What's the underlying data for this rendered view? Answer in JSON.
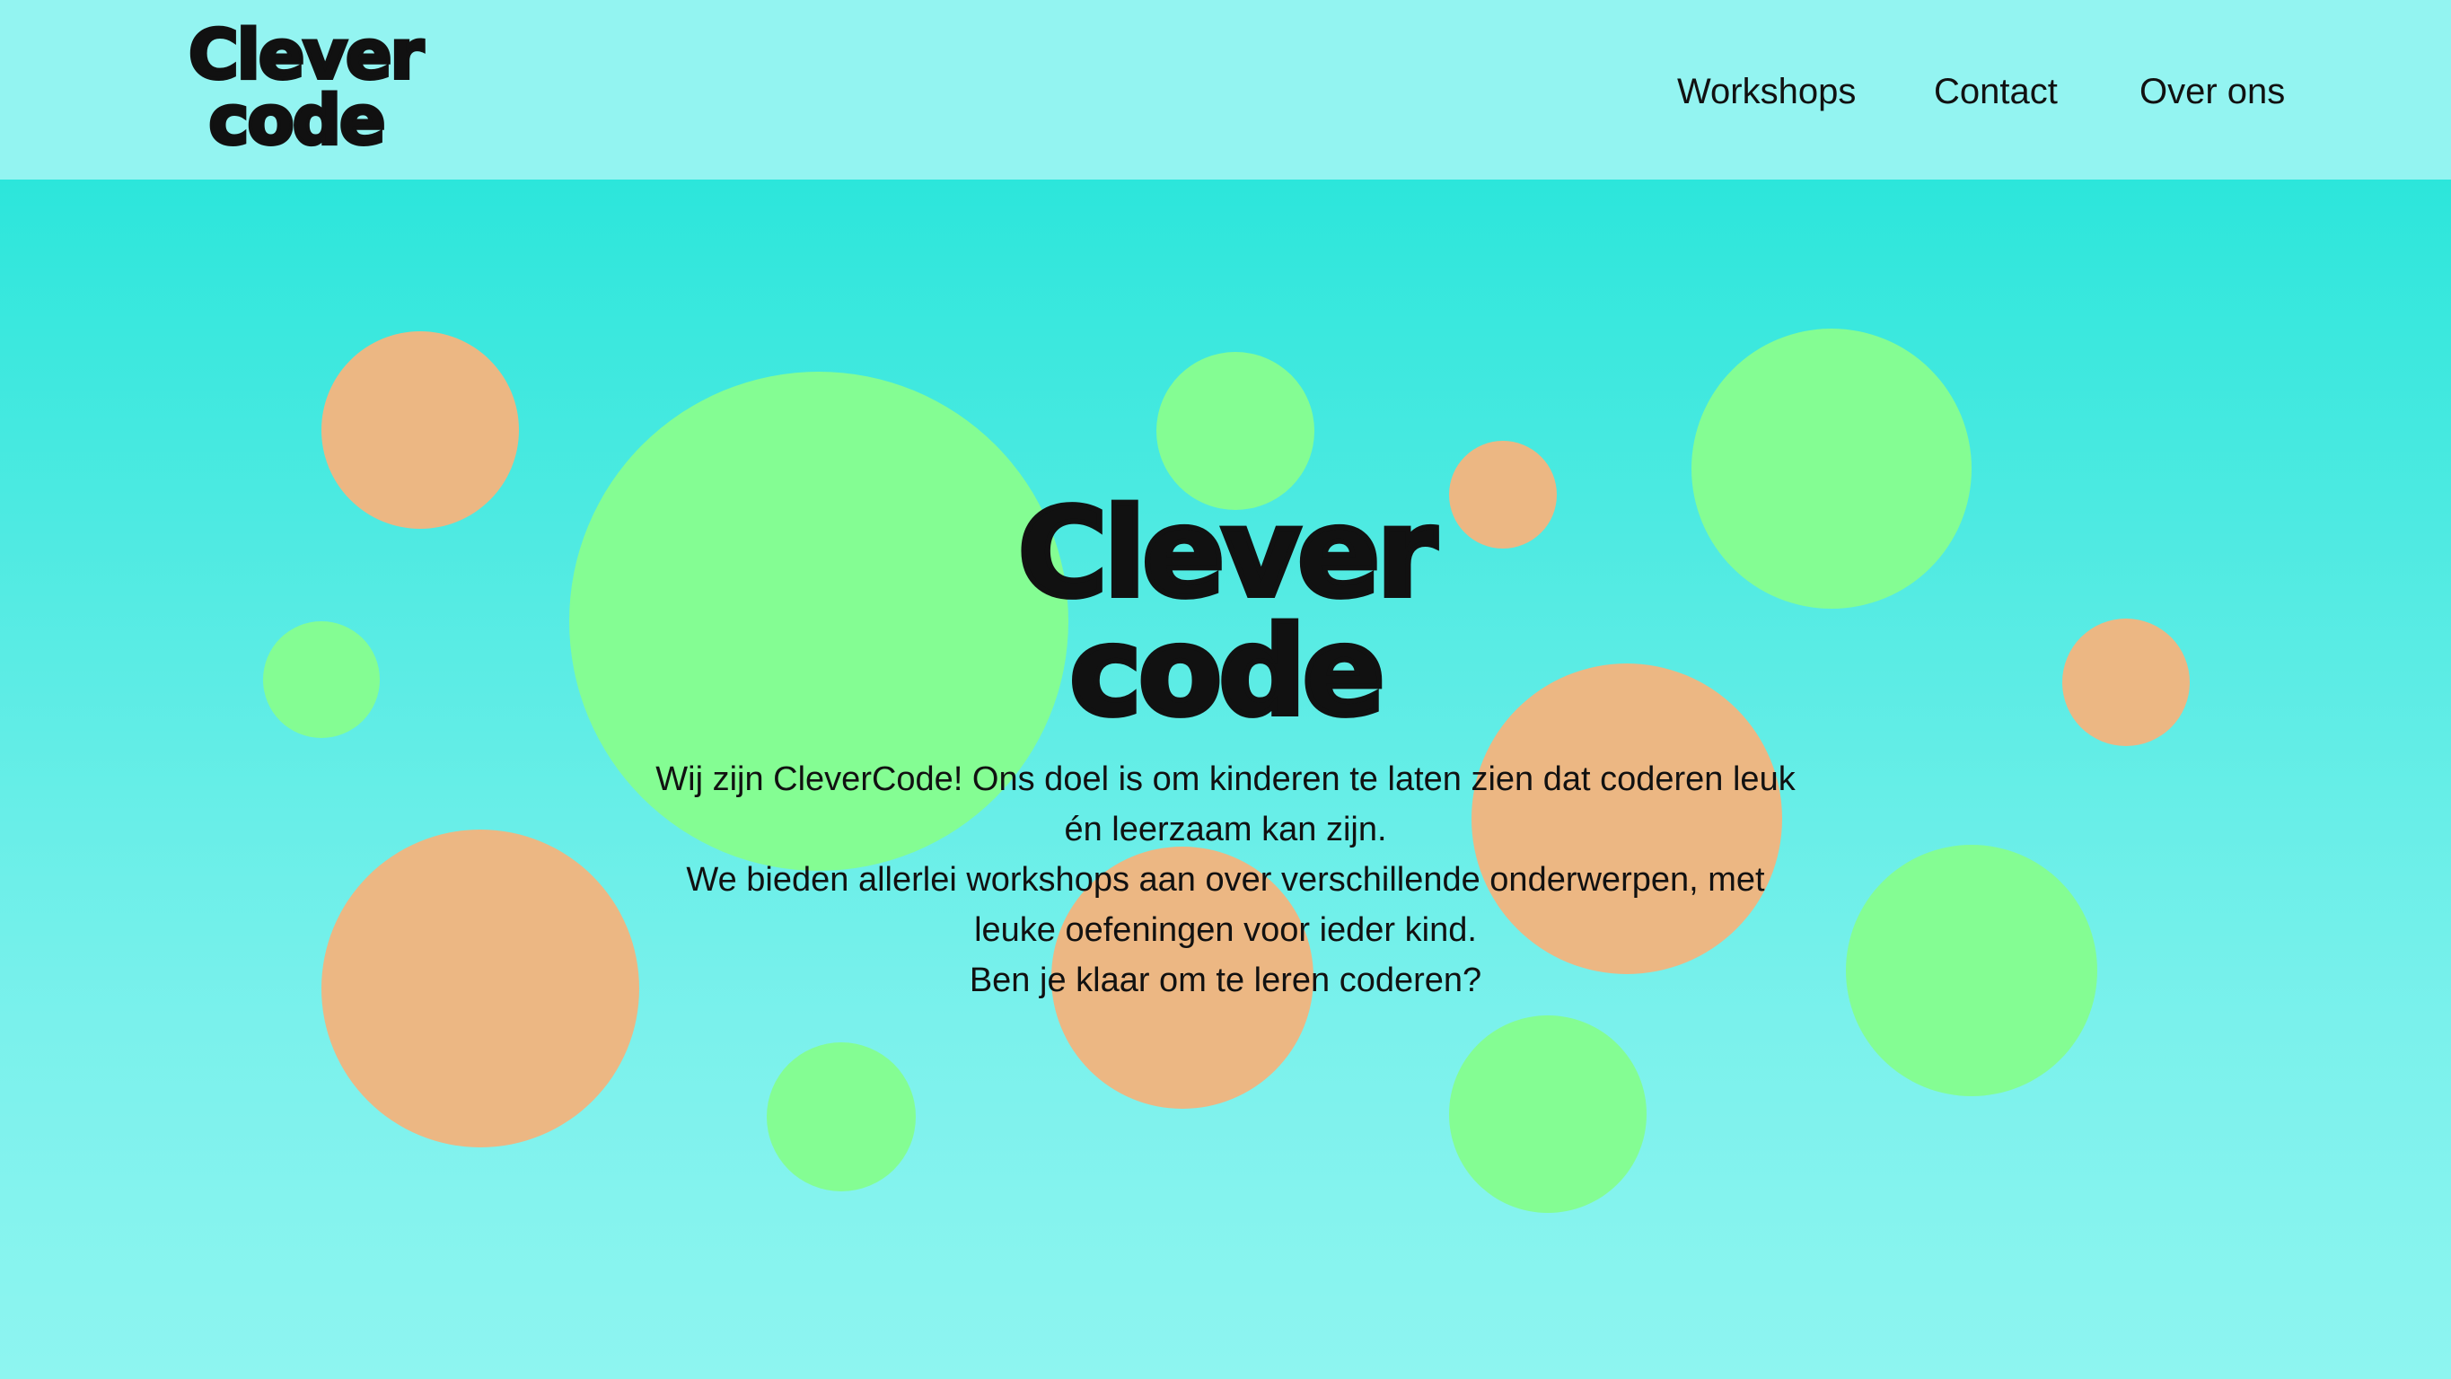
{
  "brand": {
    "logo_line1": "Clever",
    "logo_line2": "code",
    "primary_text_color": "#111111",
    "header_bg": "#93f4f1",
    "hero_gradient_top": "#2ce6db",
    "hero_gradient_bottom": "#8ef5f0",
    "bubble_green": "#84fd93",
    "bubble_peach": "#ecb783"
  },
  "nav": {
    "items": [
      {
        "label": "Workshops"
      },
      {
        "label": "Contact"
      },
      {
        "label": "Over ons"
      }
    ]
  },
  "hero": {
    "logo_line1": "Clever",
    "logo_line2": "code",
    "intro_lines": [
      "Wij zijn CleverCode! Ons doel is om kinderen te laten zien dat coderen leuk én leerzaam kan zijn.",
      "We bieden allerlei workshops aan over verschillende onderwerpen, met leuke oefeningen voor ieder kind.",
      "Ben je klaar om te leren coderen?"
    ]
  }
}
